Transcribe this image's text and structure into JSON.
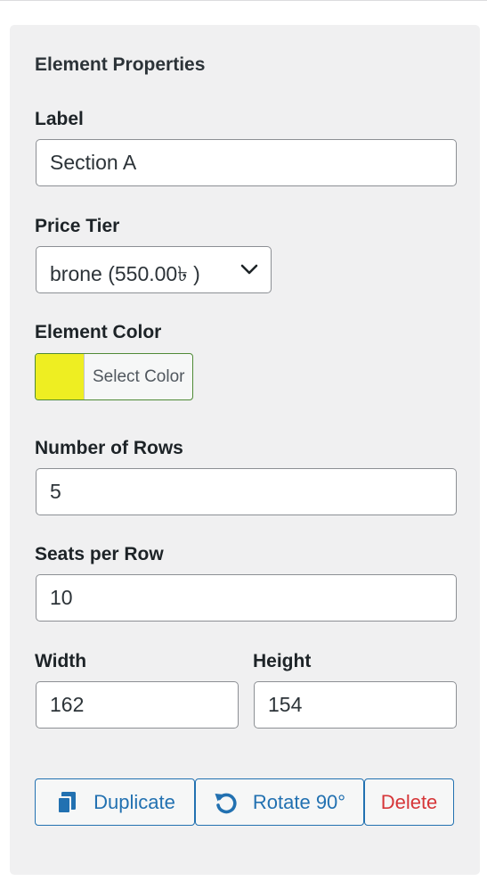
{
  "panel": {
    "title": "Element Properties"
  },
  "label_field": {
    "label": "Label",
    "value": "Section A"
  },
  "price_tier": {
    "label": "Price Tier",
    "selected": "brone (550.00৳ )"
  },
  "element_color": {
    "label": "Element Color",
    "swatch_color": "#eeee22",
    "button_text": "Select Color"
  },
  "rows_field": {
    "label": "Number of Rows",
    "value": "5"
  },
  "seats_field": {
    "label": "Seats per Row",
    "value": "10"
  },
  "width_field": {
    "label": "Width",
    "value": "162"
  },
  "height_field": {
    "label": "Height",
    "value": "154"
  },
  "actions": {
    "duplicate_label": "Duplicate",
    "duplicate_icon": "copy-icon",
    "rotate_label": "Rotate 90°",
    "rotate_icon": "rotate-icon",
    "delete_label": "Delete"
  },
  "colors": {
    "accent": "#2271b1",
    "danger": "#d63638",
    "panel_bg": "#f0f0f1"
  }
}
